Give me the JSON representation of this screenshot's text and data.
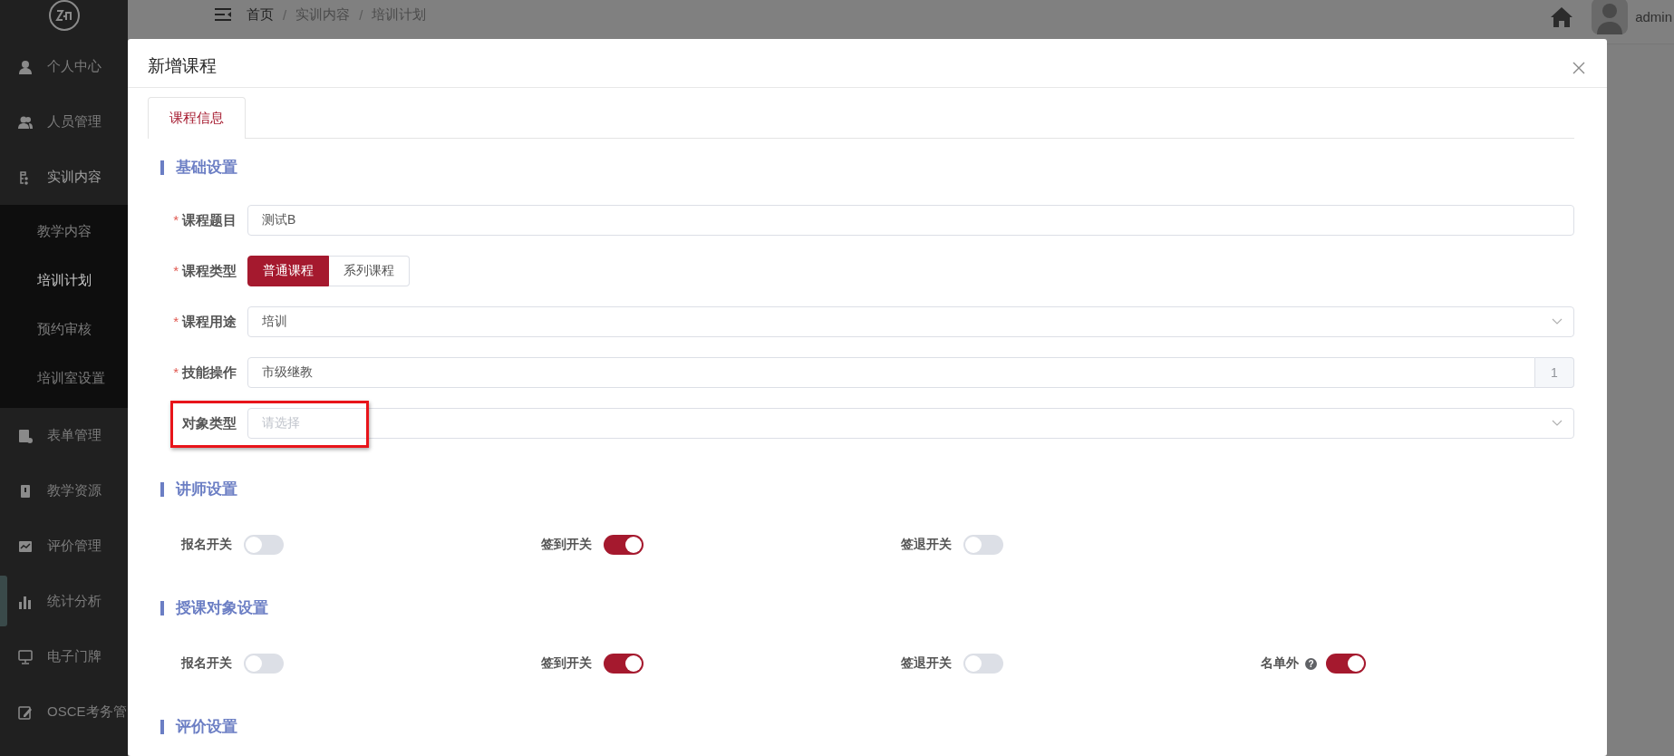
{
  "sidebar": {
    "items": [
      {
        "label": "个人中心",
        "expanded": false
      },
      {
        "label": "人员管理",
        "expanded": false
      },
      {
        "label": "实训内容",
        "expanded": true,
        "children": [
          {
            "label": "教学内容",
            "selected": false
          },
          {
            "label": "培训计划",
            "selected": true
          },
          {
            "label": "预约审核",
            "selected": false
          },
          {
            "label": "培训室设置",
            "selected": false
          }
        ]
      },
      {
        "label": "表单管理",
        "expanded": false
      },
      {
        "label": "教学资源",
        "expanded": false
      },
      {
        "label": "评价管理",
        "expanded": false
      },
      {
        "label": "统计分析",
        "expanded": false
      },
      {
        "label": "电子门牌",
        "expanded": false
      },
      {
        "label": "OSCE考务管",
        "expanded": false
      }
    ]
  },
  "header": {
    "breadcrumb": [
      "首页",
      "实训内容",
      "培训计划"
    ],
    "separators": [
      "/",
      "/"
    ],
    "user": "admin"
  },
  "dialog": {
    "title": "新增课程",
    "tabs": [
      {
        "label": "课程信息",
        "selected": true
      }
    ],
    "sections": [
      {
        "title": "基础设置",
        "fields": [
          {
            "kind": "text",
            "label": "课程题目",
            "required_mark": "*",
            "highlighted": false,
            "value": "测试B"
          },
          {
            "kind": "segmented",
            "label": "课程类型",
            "required_mark": "*",
            "highlighted": false,
            "options": [
              {
                "label": "普通课程",
                "selected": true
              },
              {
                "label": "系列课程",
                "selected": false
              }
            ]
          },
          {
            "kind": "select",
            "label": "课程用途",
            "required_mark": "*",
            "highlighted": false,
            "value": "培训"
          },
          {
            "kind": "addon",
            "label": "技能操作",
            "required_mark": "*",
            "highlighted": false,
            "value": "市级继教",
            "addon": "1"
          },
          {
            "kind": "select",
            "label": "对象类型",
            "highlighted": true,
            "placeholder": "请选择"
          }
        ]
      },
      {
        "title": "讲师设置",
        "switches": [
          {
            "label": "报名开关",
            "on": false
          },
          {
            "label": "签到开关",
            "on": true
          },
          {
            "label": "签退开关",
            "on": false
          }
        ]
      },
      {
        "title": "授课对象设置",
        "switches": [
          {
            "label": "报名开关",
            "on": false
          },
          {
            "label": "签到开关",
            "on": true
          },
          {
            "label": "签退开关",
            "on": false
          },
          {
            "label": "名单外",
            "on": true,
            "help": "?"
          }
        ]
      },
      {
        "title": "评价设置"
      }
    ]
  }
}
